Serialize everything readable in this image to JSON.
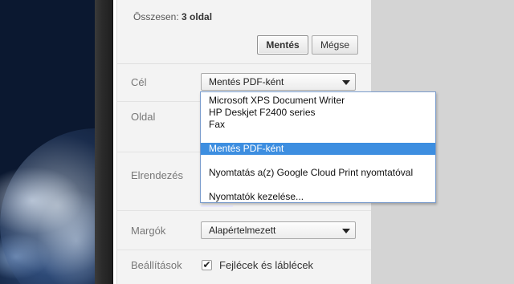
{
  "header": {
    "total_label": "Összesen:",
    "total_value": "3 oldal",
    "save_label": "Mentés",
    "cancel_label": "Mégse"
  },
  "settings": {
    "destination_label": "Cél",
    "destination_value": "Mentés PDF-ként",
    "pages_label": "Oldal",
    "layout_label": "Elrendezés",
    "margins_label": "Margók",
    "margins_value": "Alapértelmezett",
    "options_label": "Beállítások",
    "headers_footers_label": "Fejlécek és láblécek",
    "headers_footers_checked": true
  },
  "destination_dropdown": {
    "options": [
      "Microsoft XPS Document Writer",
      "HP Deskjet F2400 series",
      "Fax",
      "Mentés PDF-ként",
      "Nyomtatás a(z) Google Cloud Print nyomtatóval",
      "Nyomtatók kezelése..."
    ],
    "selected_index": 3
  },
  "colors": {
    "highlight": "#3d8ee0",
    "panel_bg": "#f3f3f3",
    "dropdown_border": "#7a9ccc"
  }
}
